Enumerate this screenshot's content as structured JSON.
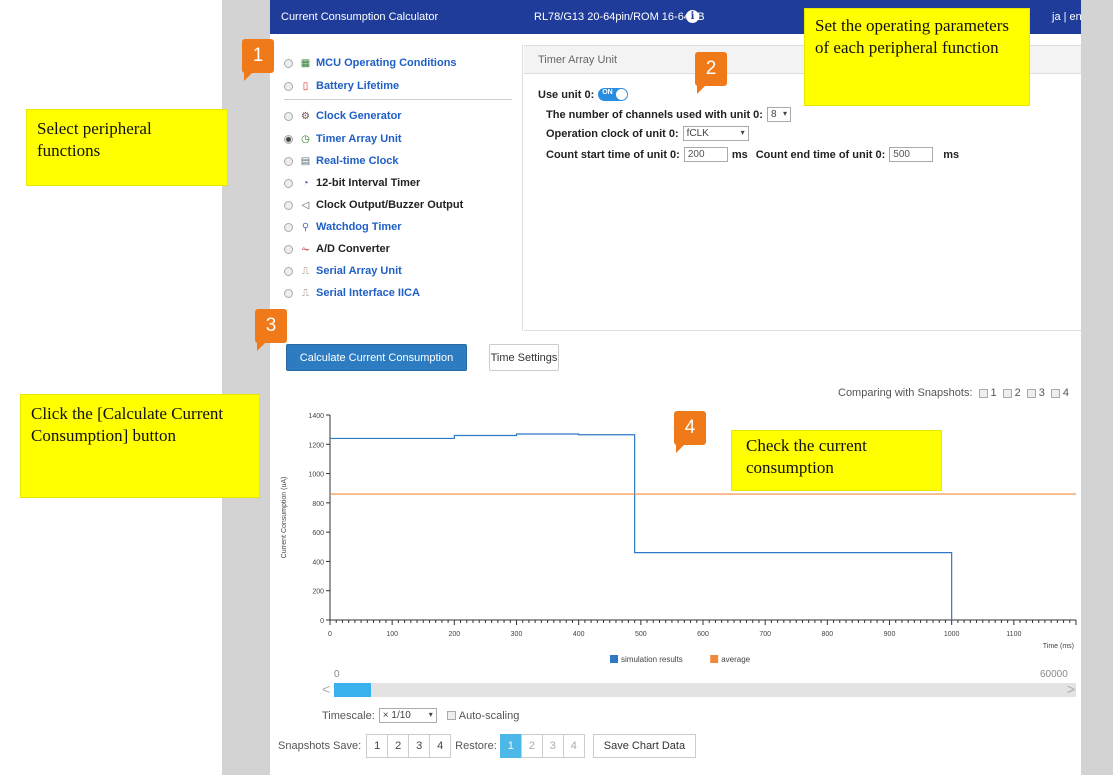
{
  "header": {
    "app_title": "Current Consumption Calculator",
    "device": "RL78/G13 20-64pin/ROM 16-64KB",
    "info_glyph": "i",
    "lang_ja": "ja",
    "lang_sep": "|",
    "lang_en": "en"
  },
  "peripherals": {
    "items": [
      {
        "label": "MCU Operating Conditions",
        "icon": "chip-icon",
        "color": "blue",
        "selected": false
      },
      {
        "label": "Battery Lifetime",
        "icon": "battery-icon",
        "color": "blue",
        "selected": false
      },
      {
        "label": "Clock Generator",
        "icon": "clock-generator-icon",
        "color": "blue",
        "selected": false
      },
      {
        "label": "Timer Array Unit",
        "icon": "timer-icon",
        "color": "blue",
        "selected": true
      },
      {
        "label": "Real-time Clock",
        "icon": "calendar-icon",
        "color": "blue",
        "selected": false
      },
      {
        "label": "12-bit Interval Timer",
        "icon": "interval-timer-icon",
        "color": "black",
        "selected": false
      },
      {
        "label": "Clock Output/Buzzer Output",
        "icon": "speaker-icon",
        "color": "black",
        "selected": false
      },
      {
        "label": "Watchdog Timer",
        "icon": "watchdog-icon",
        "color": "blue",
        "selected": false
      },
      {
        "label": "A/D Converter",
        "icon": "waveform-icon",
        "color": "black",
        "selected": false
      },
      {
        "label": "Serial Array Unit",
        "icon": "serial-icon",
        "color": "blue",
        "selected": false
      },
      {
        "label": "Serial Interface IICA",
        "icon": "serial-icon",
        "color": "blue",
        "selected": false
      }
    ]
  },
  "settings": {
    "title": "Timer Array Unit",
    "use_unit_label": "Use unit 0:",
    "toggle_text": "ON",
    "channels_label": "The number of channels used with unit 0:",
    "channels_value": "8",
    "clock_label": "Operation clock of unit 0:",
    "clock_value": "fCLK",
    "start_label": "Count start time of unit 0:",
    "start_value": "200",
    "end_label": "Count end time of unit 0:",
    "end_value": "500",
    "unit_ms": "ms"
  },
  "actions": {
    "calc_label": "Calculate Current Consumption",
    "time_settings_label": "Time Settings"
  },
  "compare": {
    "label": "Comparing with Snapshots:",
    "options": [
      "1",
      "2",
      "3",
      "4"
    ]
  },
  "chart_data": {
    "type": "line",
    "ylabel": "Current Consumption (uA)",
    "xlabel": "Time (ms)",
    "ylim": [
      0,
      1400
    ],
    "xlim": [
      0,
      1200
    ],
    "yticks": [
      0,
      200,
      400,
      600,
      800,
      1000,
      1200,
      1400
    ],
    "xticks": [
      0,
      100,
      200,
      300,
      400,
      500,
      600,
      700,
      800,
      900,
      1000,
      1100
    ],
    "legend_position": "bottom",
    "grid": false,
    "series": [
      {
        "name": "simulation results",
        "color": "#2f78c4",
        "x": [
          0,
          200,
          200,
          300,
          300,
          400,
          400,
          490,
          490,
          1000,
          1000
        ],
        "y": [
          1240,
          1240,
          1260,
          1260,
          1270,
          1270,
          1265,
          1265,
          460,
          460,
          0
        ]
      },
      {
        "name": "average",
        "color": "#f08a3c",
        "x": [
          0,
          1200
        ],
        "y": [
          860,
          860
        ]
      }
    ]
  },
  "scroller": {
    "min": "0",
    "max": "60000",
    "left_arrow": "<",
    "right_arrow": ">",
    "thumb_position": 0
  },
  "timescale": {
    "label": "Timescale:",
    "value": "× 1/10",
    "auto_label": "Auto-scaling"
  },
  "snapshots": {
    "save_label": "Snapshots Save:",
    "restore_label": "Restore:",
    "buttons": [
      "1",
      "2",
      "3",
      "4"
    ],
    "save_chart_label": "Save Chart Data"
  },
  "annotations": {
    "select": "Select peripheral functions",
    "params": "Set the operating parameters of each peripheral function",
    "calc": "Click the [Calculate Current Consumption] button",
    "check": "Check the current consumption",
    "badge_1": "1",
    "badge_2": "2",
    "badge_3": "3",
    "badge_4": "4"
  },
  "colors": {
    "header_bg": "#1f3c9a",
    "accent_blue": "#2d7cc1",
    "badge_orange": "#f07a1a",
    "note_yellow": "#ffff00"
  }
}
